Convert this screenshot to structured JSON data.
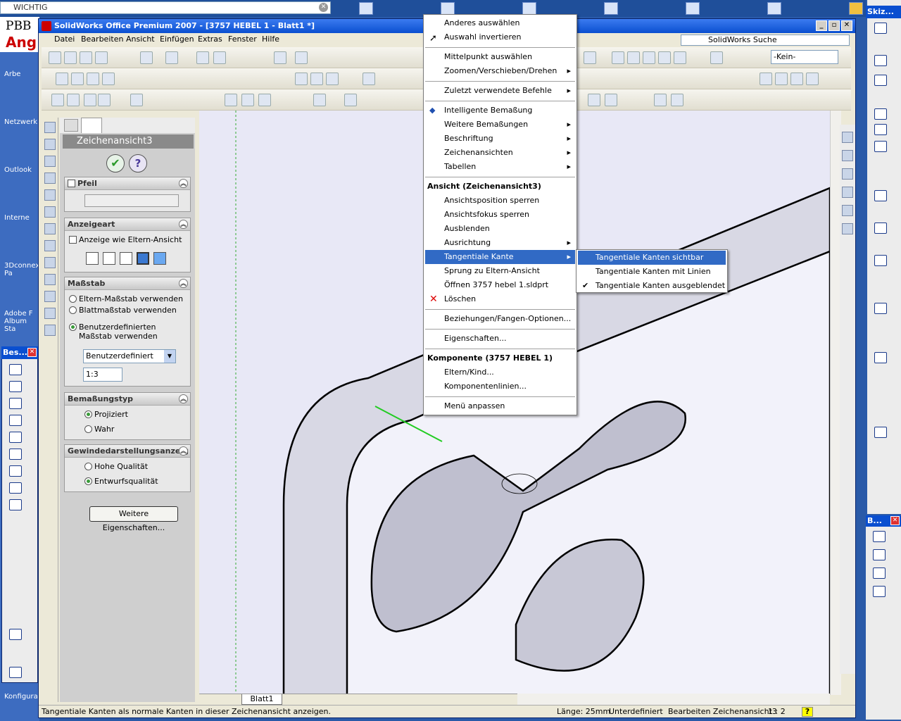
{
  "desktop": {
    "search_text": "WICHTIG",
    "pbb_top": "PBB",
    "pbb_sub": "Ang",
    "icons": [
      "Arbe",
      "Netzwerk",
      "Outlook",
      "Interne",
      "3Dconnex Pa",
      "Adobe F Album Sta",
      "Konfigura"
    ]
  },
  "window": {
    "title": "SolidWorks Office Premium 2007 - [3757 HEBEL 1 - Blatt1 *]",
    "search_placeholder": "SolidWorks Suche",
    "config_select": "-Kein-"
  },
  "menu": [
    "Datei",
    "Bearbeiten",
    "Ansicht",
    "Einfügen",
    "Extras",
    "Fenster",
    "Hilfe"
  ],
  "panel": {
    "title": "Zeichenansicht3",
    "pfeil": {
      "title": "Pfeil"
    },
    "anzeigeart": {
      "title": "Anzeigeart",
      "checkbox": "Anzeige wie Eltern-Ansicht"
    },
    "massstab": {
      "title": "Maßstab",
      "opt1": "Eltern-Maßstab verwenden",
      "opt2": "Blattmaßstab verwenden",
      "opt3": "Benutzerdefinierten Maßstab verwenden",
      "select": "Benutzerdefiniert",
      "value": "1:3"
    },
    "bemassungstyp": {
      "title": "Bemaßungstyp",
      "opt1": "Projiziert",
      "opt2": "Wahr"
    },
    "gewinde": {
      "title": "Gewindedarstellungsanzeig",
      "opt1": "Hohe Qualität",
      "opt2": "Entwurfsqualität"
    },
    "more_button": "Weitere Eigenschaften..."
  },
  "context_menu": {
    "items": [
      "Anderes auswählen",
      "Auswahl invertieren",
      "Mittelpunkt auswählen",
      "Zoomen/Verschieben/Drehen",
      "Zuletzt verwendete Befehle",
      "Intelligente Bemaßung",
      "Weitere Bemaßungen",
      "Beschriftung",
      "Zeichenansichten",
      "Tabellen"
    ],
    "section_view": "Ansicht (Zeichenansicht3)",
    "view_items": [
      "Ansichtsposition sperren",
      "Ansichtsfokus sperren",
      "Ausblenden",
      "Ausrichtung",
      "Tangentiale Kante",
      "Sprung zu Eltern-Ansicht",
      "Öffnen 3757 hebel 1.sldprt",
      "Löschen",
      "Beziehungen/Fangen-Optionen...",
      "Eigenschaften..."
    ],
    "section_comp": "Komponente (3757 HEBEL 1)",
    "comp_items": [
      "Eltern/Kind...",
      "Komponentenlinien...",
      "Menü anpassen"
    ]
  },
  "submenu": [
    "Tangentiale Kanten sichtbar",
    "Tangentiale Kanten mit Linien",
    "Tangentiale Kanten ausgeblendet"
  ],
  "sheet_tab": "Blatt1",
  "status": {
    "hint": "Tangentiale Kanten als normale Kanten in dieser Zeichenansicht anzeigen.",
    "length": "Länge: 25mm",
    "state": "Unterdefiniert",
    "mode": "Bearbeiten Zeichenansicht3",
    "scale": "1 : 2"
  },
  "side_toolbars": {
    "skizze": "Skiz...",
    "bes1": "Bes...",
    "bes2": "B..."
  }
}
